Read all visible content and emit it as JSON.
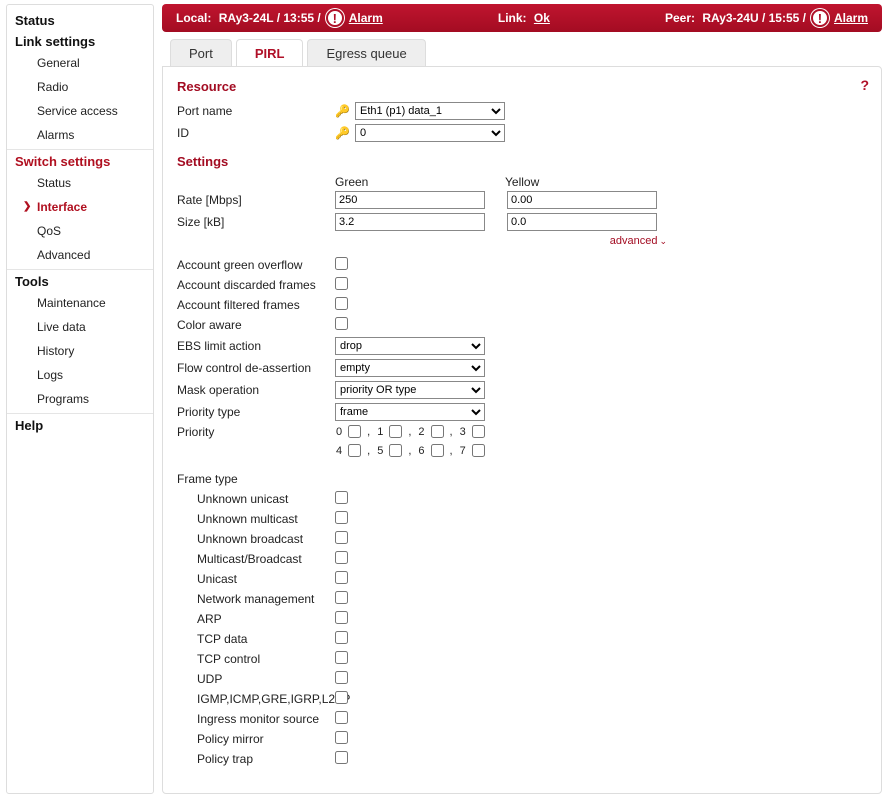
{
  "sidebar": {
    "groups": [
      {
        "title": "Status",
        "items": []
      },
      {
        "title": "Link settings",
        "items": [
          {
            "label": "General"
          },
          {
            "label": "Radio"
          },
          {
            "label": "Service access"
          },
          {
            "label": "Alarms"
          }
        ]
      },
      {
        "title": "Switch settings",
        "active_title": true,
        "items": [
          {
            "label": "Status"
          },
          {
            "label": "Interface",
            "active": true
          },
          {
            "label": "QoS"
          },
          {
            "label": "Advanced"
          }
        ]
      },
      {
        "title": "Tools",
        "items": [
          {
            "label": "Maintenance"
          },
          {
            "label": "Live data"
          },
          {
            "label": "History"
          },
          {
            "label": "Logs"
          },
          {
            "label": "Programs"
          }
        ]
      },
      {
        "title": "Help",
        "items": []
      }
    ]
  },
  "statusbar": {
    "local_label": "Local:",
    "local_value": "RAy3-24L / 13:55 /",
    "local_alarm": "Alarm",
    "link_label": "Link:",
    "link_value": "Ok",
    "peer_label": "Peer:",
    "peer_value": "RAy3-24U / 15:55 /",
    "peer_alarm": "Alarm"
  },
  "tabs": [
    {
      "label": "Port"
    },
    {
      "label": "PIRL",
      "active": true
    },
    {
      "label": "Egress queue"
    }
  ],
  "help": "?",
  "resource": {
    "title": "Resource",
    "port_name_label": "Port name",
    "port_name_value": "Eth1 (p1) data_1",
    "id_label": "ID",
    "id_value": "0"
  },
  "settings": {
    "title": "Settings",
    "col_green": "Green",
    "col_yellow": "Yellow",
    "rate_label": "Rate [Mbps]",
    "rate_green": "250",
    "rate_yellow": "0.00",
    "size_label": "Size [kB]",
    "size_green": "3.2",
    "size_yellow": "0.0",
    "advanced_label": "advanced",
    "account_green_overflow": "Account green overflow",
    "account_discarded": "Account discarded frames",
    "account_filtered": "Account filtered frames",
    "color_aware": "Color aware",
    "ebs_label": "EBS limit action",
    "ebs_value": "drop",
    "flow_label": "Flow control de-assertion",
    "flow_value": "empty",
    "mask_label": "Mask operation",
    "mask_value": "priority OR type",
    "ptype_label": "Priority type",
    "ptype_value": "frame",
    "priority_label": "Priority",
    "prio": [
      "0",
      "1",
      "2",
      "3",
      "4",
      "5",
      "6",
      "7"
    ],
    "frame_type_label": "Frame type",
    "frame_types": [
      "Unknown unicast",
      "Unknown multicast",
      "Unknown broadcast",
      "Multicast/Broadcast",
      "Unicast",
      "Network management",
      "ARP",
      "TCP data",
      "TCP control",
      "UDP",
      "IGMP,ICMP,GRE,IGRP,L2TP",
      "Ingress monitor source",
      "Policy mirror",
      "Policy trap"
    ]
  }
}
